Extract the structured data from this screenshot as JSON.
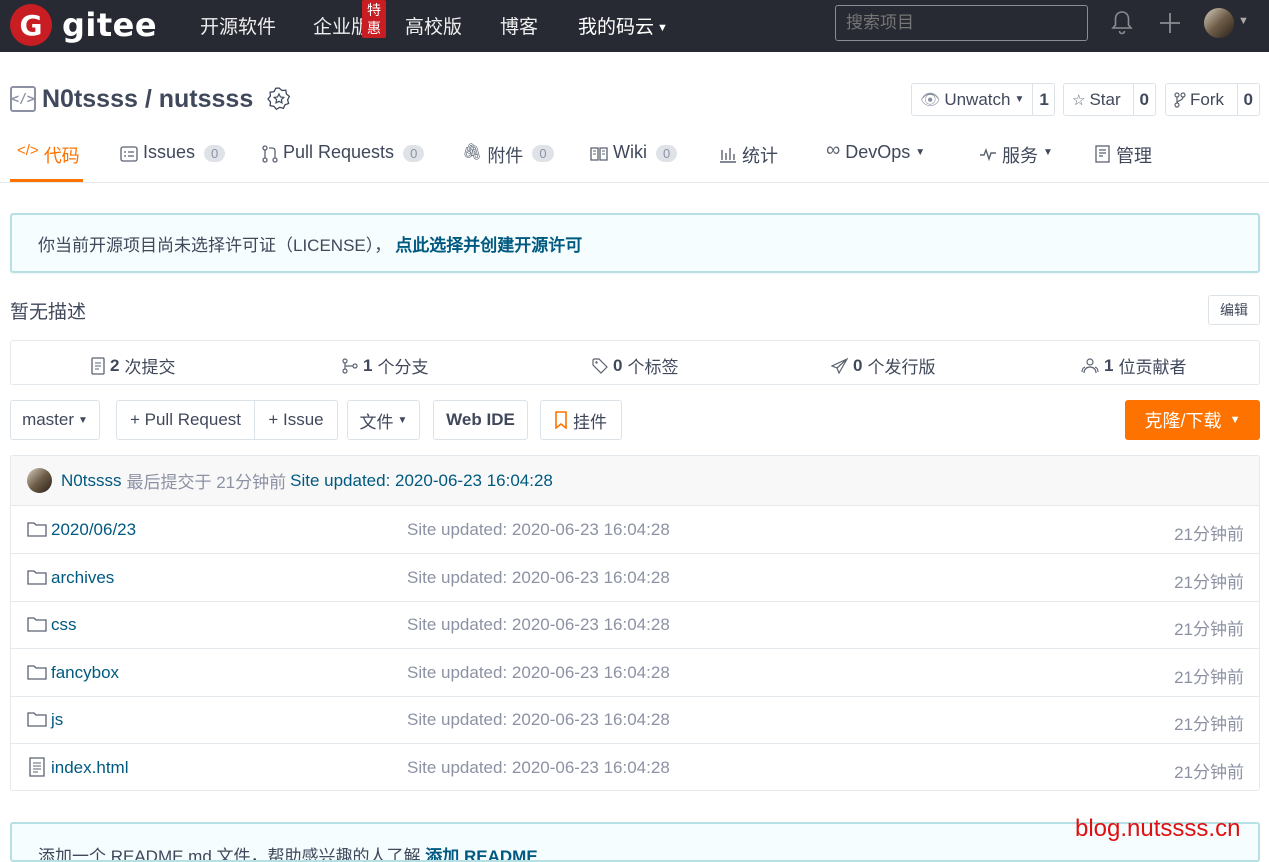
{
  "topbar": {
    "logo_letter": "G",
    "logo_text": "gitee",
    "nav": [
      {
        "label": "开源软件"
      },
      {
        "label": "企业版"
      },
      {
        "label": "高校版"
      },
      {
        "label": "博客"
      },
      {
        "label": "我的码云"
      }
    ],
    "enterprise_badge": "特惠",
    "search_placeholder": "搜索项目",
    "icons": [
      "bell-icon",
      "plus-icon",
      "avatar"
    ]
  },
  "repo": {
    "title": "N0tssss / nutssss",
    "watch_label": "Unwatch",
    "watch_count": "1",
    "star_label": "Star",
    "star_count": "0",
    "fork_label": "Fork",
    "fork_count": "0"
  },
  "tabs": [
    {
      "label": "代码",
      "icon": "code-icon",
      "active": true
    },
    {
      "label": "Issues",
      "count": "0",
      "icon": "issues-icon"
    },
    {
      "label": "Pull Requests",
      "count": "0",
      "icon": "pull-request-icon"
    },
    {
      "label": "附件",
      "count": "0",
      "icon": "attachment-icon"
    },
    {
      "label": "Wiki",
      "count": "0",
      "icon": "wiki-icon"
    },
    {
      "label": "统计",
      "icon": "chart-icon"
    },
    {
      "label": "DevOps",
      "icon": "infinity-icon"
    },
    {
      "label": "服务",
      "icon": "pulse-icon"
    },
    {
      "label": "管理",
      "icon": "manage-icon"
    }
  ],
  "license_notice": {
    "text": "你当前开源项目尚未选择许可证（LICENSE），",
    "link": "点此选择并创建开源许可"
  },
  "description": "暂无描述",
  "edit_label": "编辑",
  "stats": [
    {
      "num": "2",
      "label": "次提交"
    },
    {
      "num": "1",
      "label": "个分支"
    },
    {
      "num": "0",
      "label": "个标签"
    },
    {
      "num": "0",
      "label": "个发行版"
    },
    {
      "num": "1",
      "label": "位贡献者"
    }
  ],
  "toolbar": {
    "branch": "master",
    "pull_request": "+ Pull Request",
    "issue": "+ Issue",
    "file": "文件",
    "web_ide": "Web IDE",
    "widget": "挂件",
    "clone": "克隆/下载"
  },
  "commit": {
    "user": "N0tssss",
    "meta": "最后提交于 21分钟前",
    "message": "Site updated: 2020-06-23 16:04:28"
  },
  "files": [
    {
      "name": "2020/06/23",
      "type": "folder",
      "msg": "Site updated: 2020-06-23 16:04:28",
      "time": "21分钟前"
    },
    {
      "name": "archives",
      "type": "folder",
      "msg": "Site updated: 2020-06-23 16:04:28",
      "time": "21分钟前"
    },
    {
      "name": "css",
      "type": "folder",
      "msg": "Site updated: 2020-06-23 16:04:28",
      "time": "21分钟前"
    },
    {
      "name": "fancybox",
      "type": "folder",
      "msg": "Site updated: 2020-06-23 16:04:28",
      "time": "21分钟前"
    },
    {
      "name": "js",
      "type": "folder",
      "msg": "Site updated: 2020-06-23 16:04:28",
      "time": "21分钟前"
    },
    {
      "name": "index.html",
      "type": "file",
      "msg": "Site updated: 2020-06-23 16:04:28",
      "time": "21分钟前"
    }
  ],
  "readme_notice": {
    "text": "添加一个 README.md 文件，帮助感兴趣的人了解",
    "link": "添加 README"
  },
  "watermark": "blog.nutssss.cn",
  "colors": {
    "accent": "#fe7300",
    "topbar": "#272a33",
    "link": "#005980",
    "brand_red": "#c71d23"
  }
}
